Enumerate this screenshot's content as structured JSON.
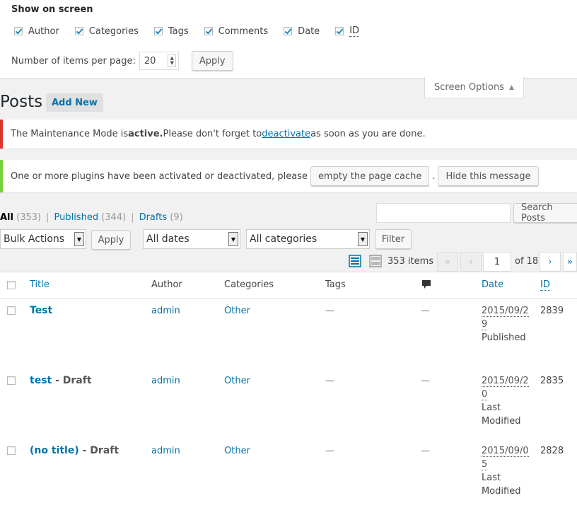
{
  "screen_options": {
    "title": "Show on screen",
    "columns": [
      {
        "label": "Author",
        "checked": true
      },
      {
        "label": "Categories",
        "checked": true
      },
      {
        "label": "Tags",
        "checked": true
      },
      {
        "label": "Comments",
        "checked": true
      },
      {
        "label": "Date",
        "checked": true
      },
      {
        "label": "ID",
        "checked": true
      }
    ],
    "per_page_label": "Number of items per page:",
    "per_page_value": "20",
    "apply_label": "Apply",
    "tab_label": "Screen Options",
    "tab_arrow": "▲"
  },
  "heading": {
    "title": "Posts",
    "add_new": "Add New"
  },
  "notices": {
    "maintenance": {
      "text_before": "The Maintenance Mode is ",
      "strong": "active.",
      "text_mid": " Please don't forget to ",
      "link": "deactivate",
      "text_after": " as soon as you are done."
    },
    "plugins": {
      "text": "One or more plugins have been activated or deactivated, please",
      "button1": "empty the page cache",
      "dot": ".",
      "button2": "Hide this message"
    }
  },
  "filters": {
    "all": "All",
    "all_count": "(353)",
    "published": "Published",
    "published_count": "(344)",
    "drafts": "Drafts",
    "drafts_count": "(9)",
    "sep": "|"
  },
  "search": {
    "button": "Search Posts"
  },
  "tablenav": {
    "bulk_actions": "Bulk Actions",
    "apply": "Apply",
    "dates": "All dates",
    "categories": "All categories",
    "filter": "Filter",
    "items": "353 items",
    "first": "«",
    "prev": "‹",
    "current_page": "1",
    "of_pages": "of 18",
    "next": "›",
    "last": "»"
  },
  "table": {
    "columns": {
      "title": "Title",
      "author": "Author",
      "categories": "Categories",
      "tags": "Tags",
      "date": "Date",
      "id": "ID"
    },
    "rows": [
      {
        "title": "Test",
        "state": "",
        "author": "admin",
        "category": "Other",
        "tags": "—",
        "comments": "—",
        "date_l1": "2015/09/2",
        "date_l2": "9",
        "status_l1": "Published",
        "status_l2": "",
        "id": "2839"
      },
      {
        "title": "test",
        "state": " - Draft",
        "author": "admin",
        "category": "Other",
        "tags": "—",
        "comments": "—",
        "date_l1": "2015/09/2",
        "date_l2": "0",
        "status_l1": "Last",
        "status_l2": "Modified",
        "id": "2835"
      },
      {
        "title": "(no title)",
        "state": " - Draft",
        "author": "admin",
        "category": "Other",
        "tags": "—",
        "comments": "—",
        "date_l1": "2015/09/0",
        "date_l2": "5",
        "status_l1": "Last",
        "status_l2": "Modified",
        "id": "2828"
      }
    ]
  },
  "colors": {
    "link": "#0073aa",
    "error": "#dc3232",
    "success": "#7ad03a"
  }
}
